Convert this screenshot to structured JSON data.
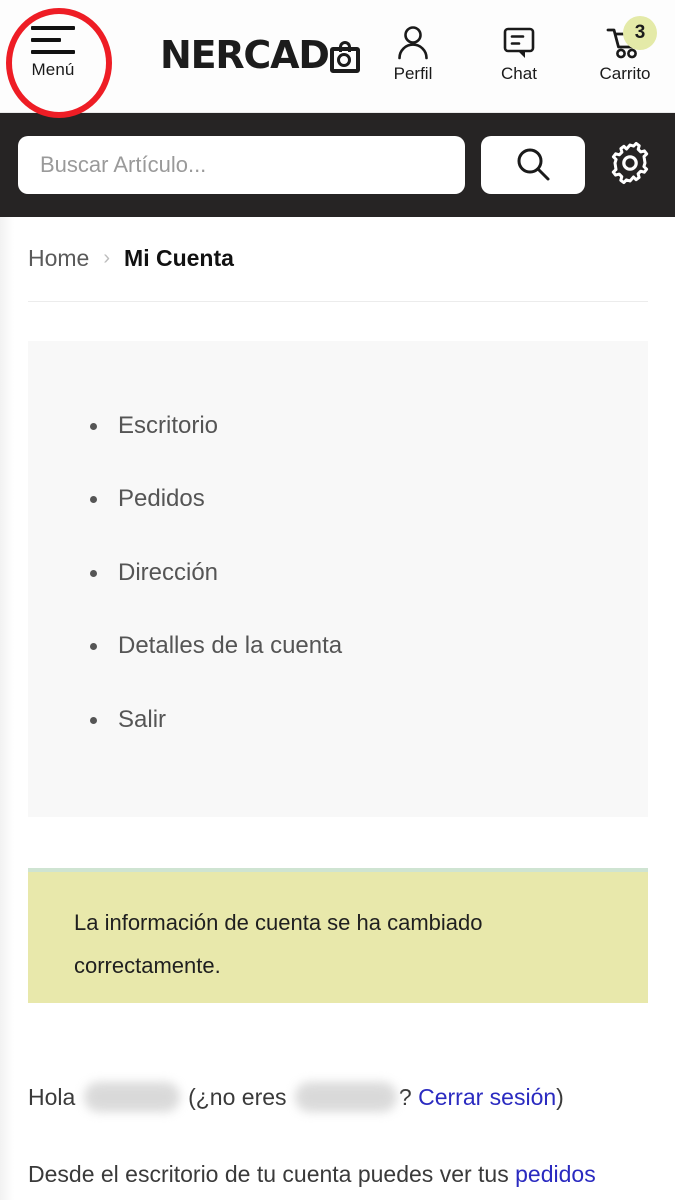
{
  "header": {
    "menu": {
      "label": "Menú",
      "icon": "hamburger-icon"
    },
    "brand": {
      "text": "NERCAD",
      "glyph_icon": "shopping-bag-icon"
    },
    "actions": [
      {
        "label": "Perfil",
        "icon": "person-icon"
      },
      {
        "label": "Chat",
        "icon": "chat-bubble-icon"
      },
      {
        "label": "Carrito",
        "icon": "shopping-cart-icon",
        "badge": "3"
      }
    ],
    "annotation": {
      "name": "red-highlight-circle",
      "color": "#ee1d25"
    }
  },
  "search": {
    "placeholder": "Buscar Artículo...",
    "value": "",
    "submit_icon": "search-icon",
    "settings_icon": "gear-icon",
    "bar_color": "#262424"
  },
  "breadcrumb": {
    "home": "Home",
    "separator": "›",
    "current": "Mi Cuenta"
  },
  "account_menu": {
    "items": [
      {
        "label": "Escritorio"
      },
      {
        "label": "Pedidos"
      },
      {
        "label": "Dirección"
      },
      {
        "label": "Detalles de la cuenta"
      },
      {
        "label": "Salir"
      }
    ]
  },
  "notice": {
    "message": "La información de cuenta se ha cambiado correctamente.",
    "background": "#e8e8ab",
    "border_color": "#cfe4d2"
  },
  "greeting": {
    "hello": "Hola",
    "not_you_prefix": "(¿no eres",
    "question_mark": "?",
    "logout_link": "Cerrar sesión",
    "closing_paren": ")",
    "name_redacted": true
  },
  "description": {
    "text_before": "Desde el escritorio de tu cuenta puedes ver tus",
    "orders_link": "pedidos"
  },
  "colors": {
    "link": "#2a2ac0",
    "dark_bar": "#262424",
    "panel": "#f8f8f8",
    "cart_badge": "#e4eaa8"
  }
}
